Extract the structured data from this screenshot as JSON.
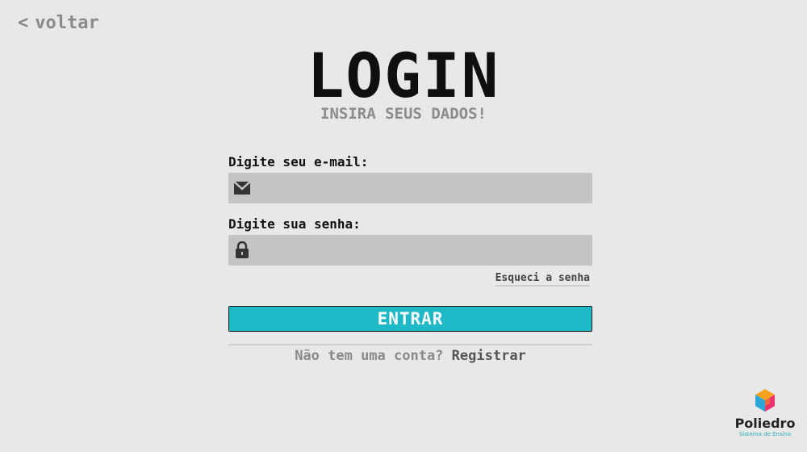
{
  "nav": {
    "back_chevron": "<",
    "back_label": "voltar"
  },
  "header": {
    "title": "LOGIN",
    "subtitle": "INSIRA SEUS DADOS!"
  },
  "form": {
    "email_label": "Digite seu e-mail:",
    "email_value": "",
    "email_icon": "envelope-icon",
    "password_label": "Digite sua senha:",
    "password_value": "",
    "password_icon": "lock-icon",
    "forgot_label": "Esqueci a senha",
    "submit_label": "ENTRAR"
  },
  "register": {
    "prompt": "Não tem uma conta?",
    "link": "Registrar"
  },
  "brand": {
    "name": "Poliedro",
    "tagline": "Sistema de Ensino"
  },
  "colors": {
    "background": "#e8e8e8",
    "accent": "#1fb8c7",
    "field": "#c4c4c4"
  }
}
